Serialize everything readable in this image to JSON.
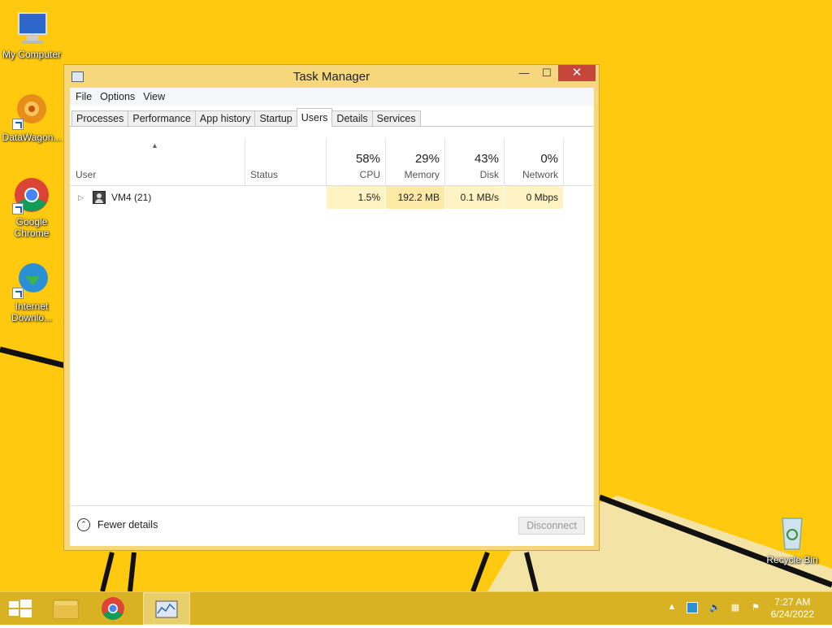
{
  "desktop": {
    "icons": [
      {
        "label_line1": "My Computer",
        "label_line2": ""
      },
      {
        "label_line1": "DataWagon...",
        "label_line2": ""
      },
      {
        "label_line1": "Google",
        "label_line2": "Chrome"
      },
      {
        "label_line1": "Internet",
        "label_line2": "Downlo..."
      },
      {
        "label_line1": "Recycle Bin",
        "label_line2": ""
      }
    ]
  },
  "window": {
    "title": "Task Manager",
    "buttons": {
      "minimize": "—",
      "maximize": "☐",
      "close": "✕"
    },
    "menu": [
      "File",
      "Options",
      "View"
    ],
    "tabs": [
      "Processes",
      "Performance",
      "App history",
      "Startup",
      "Users",
      "Details",
      "Services"
    ],
    "active_tab": "Users",
    "columns": {
      "user": {
        "label": "User"
      },
      "status": {
        "label": "Status"
      },
      "cpu": {
        "percent": "58%",
        "label": "CPU"
      },
      "memory": {
        "percent": "29%",
        "label": "Memory"
      },
      "disk": {
        "percent": "43%",
        "label": "Disk"
      },
      "network": {
        "percent": "0%",
        "label": "Network"
      }
    },
    "rows": [
      {
        "user": "VM4 (21)",
        "status": "",
        "cpu": "1.5%",
        "memory": "192.2 MB",
        "disk": "0.1 MB/s",
        "network": "0 Mbps"
      }
    ],
    "footer": {
      "fewer_details": "Fewer details",
      "disconnect": "Disconnect"
    }
  },
  "taskbar": {
    "time": "7:27 AM",
    "date": "6/24/2022"
  },
  "colors": {
    "desktop": "#fec90e",
    "window_frame": "#f6d77c",
    "close_button": "#c7463c",
    "taskbar": "#d8b222"
  }
}
